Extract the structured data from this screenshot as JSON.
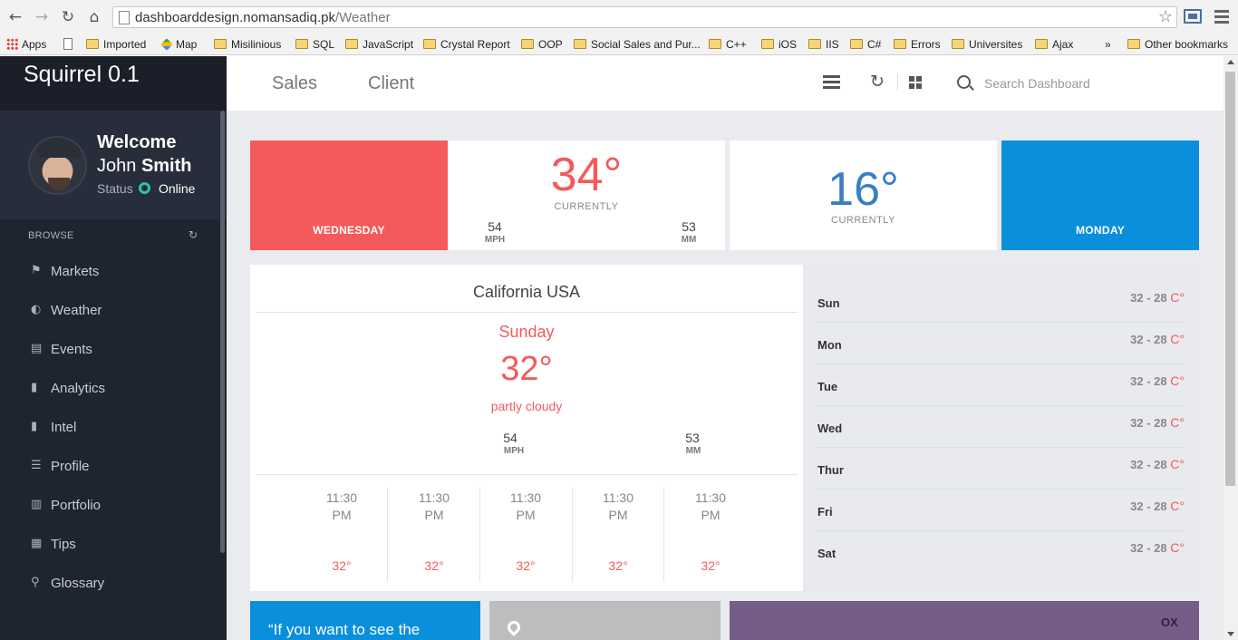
{
  "browser": {
    "url_host": "dashboarddesign.nomansadiq.pk",
    "url_path": "/Weather",
    "bookmarks": [
      "Apps",
      "Imported",
      "Map",
      "Misilinious",
      "SQL",
      "JavaScript",
      "Crystal Report",
      "OOP",
      "Social Sales and Pur...",
      "C++",
      "iOS",
      "IIS",
      "C#",
      "Errors",
      "Universites",
      "Ajax",
      "»",
      "Other bookmarks"
    ]
  },
  "sidebar": {
    "brand": "Squirrel 0.1",
    "welcome": "Welcome",
    "user_first": "John",
    "user_last": "Smith",
    "status_label": "Status",
    "status_value": "Online",
    "browse_label": "BROWSE",
    "items": [
      {
        "label": "Markets",
        "icon": "flag-icon"
      },
      {
        "label": "Weather",
        "icon": "half-circle-icon"
      },
      {
        "label": "Events",
        "icon": "document-icon"
      },
      {
        "label": "Analytics",
        "icon": "bookmark-icon"
      },
      {
        "label": "Intel",
        "icon": "bookmark-icon"
      },
      {
        "label": "Profile",
        "icon": "list-icon"
      },
      {
        "label": "Portfolio",
        "icon": "book-icon"
      },
      {
        "label": "Tips",
        "icon": "grid-icon"
      },
      {
        "label": "Glossary",
        "icon": "map-pin-icon"
      }
    ]
  },
  "header": {
    "tabs": [
      "Sales",
      "Client"
    ],
    "search_placeholder": "Search Dashboard"
  },
  "cards": {
    "day1": "WEDNESDAY",
    "temp1": "34°",
    "currently": "CURRENTLY",
    "wind1": "54",
    "wind_unit": "MPH",
    "rain1": "53",
    "rain_unit": "MM",
    "temp2": "16°",
    "day2": "MONDAY"
  },
  "city": {
    "name": "California USA",
    "day": "Sunday",
    "temp": "32°",
    "condition": "partly cloudy",
    "wind": "54",
    "wind_unit": "MPH",
    "rain": "53",
    "rain_unit": "MM",
    "hours": [
      {
        "time": "11:30",
        "ampm": "PM",
        "temp": "32°"
      },
      {
        "time": "11:30",
        "ampm": "PM",
        "temp": "32°"
      },
      {
        "time": "11:30",
        "ampm": "PM",
        "temp": "32°"
      },
      {
        "time": "11:30",
        "ampm": "PM",
        "temp": "32°"
      },
      {
        "time": "11:30",
        "ampm": "PM",
        "temp": "32°"
      }
    ]
  },
  "week": [
    {
      "day": "Sun",
      "range": "32 - 28",
      "unit": "C°"
    },
    {
      "day": "Mon",
      "range": "32 - 28",
      "unit": "C°"
    },
    {
      "day": "Tue",
      "range": "32 - 28",
      "unit": "C°"
    },
    {
      "day": "Wed",
      "range": "32 - 28",
      "unit": "C°"
    },
    {
      "day": "Thur",
      "range": "32 - 28",
      "unit": "C°"
    },
    {
      "day": "Fri",
      "range": "32 - 28",
      "unit": "C°"
    },
    {
      "day": "Sat",
      "range": "32 - 28",
      "unit": "C°"
    }
  ],
  "bottom": {
    "quote": "“If you want to see the",
    "purple_icon": "OX"
  },
  "colors": {
    "accent_red": "#f45a5a",
    "accent_blue": "#0a8fdb",
    "sidebar_bg": "#1e2430",
    "online_green": "#2ec4a5",
    "purple": "#745d87"
  }
}
